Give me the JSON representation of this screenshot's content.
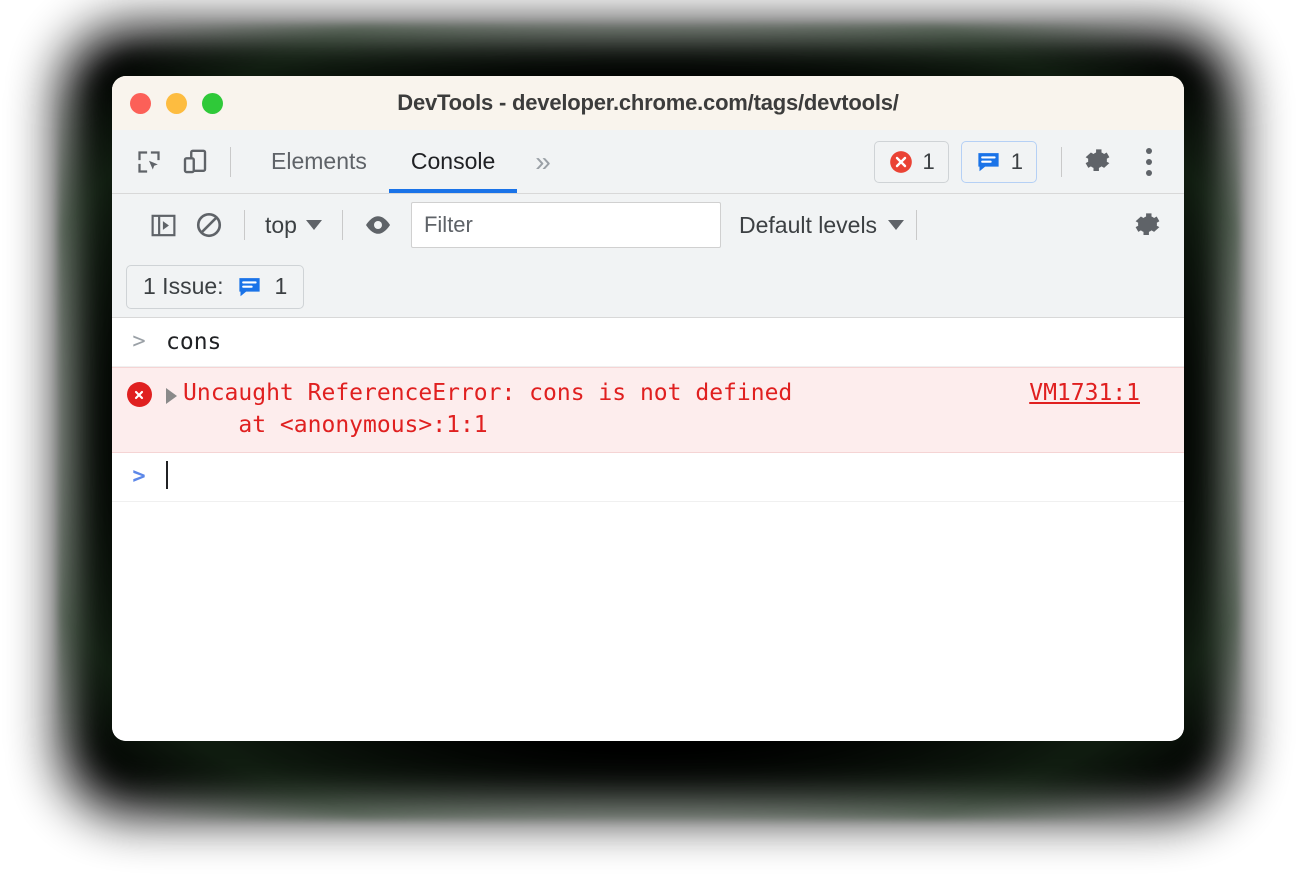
{
  "window": {
    "title": "DevTools - developer.chrome.com/tags/devtools/",
    "traffic_lights": [
      {
        "name": "close",
        "color": "#fc6058"
      },
      {
        "name": "minimize",
        "color": "#fdbc40"
      },
      {
        "name": "maximize",
        "color": "#2fc939"
      }
    ]
  },
  "main_toolbar": {
    "inspect_icon": "inspect-element-icon",
    "device_icon": "device-toolbar-icon",
    "tabs": [
      {
        "label": "Elements",
        "active": false
      },
      {
        "label": "Console",
        "active": true
      }
    ],
    "more_tabs_label": "»",
    "error_count": "1",
    "issue_count": "1",
    "settings_icon": "gear-icon",
    "more_options_icon": "kebab-menu-icon"
  },
  "console_toolbar": {
    "sidebar_icon": "console-sidebar-icon",
    "clear_icon": "clear-console-icon",
    "context": "top",
    "eye_icon": "live-expression-icon",
    "filter_placeholder": "Filter",
    "filter_value": "",
    "levels": "Default levels",
    "settings_icon": "gear-icon"
  },
  "issues_bar": {
    "label": "1 Issue:",
    "count": "1"
  },
  "console": {
    "entries": [
      {
        "type": "input",
        "prompt": ">",
        "text": "cons"
      },
      {
        "type": "error",
        "message": "Uncaught ReferenceError: cons is not defined",
        "stack": "    at <anonymous>:1:1",
        "link": "VM1731:1"
      },
      {
        "type": "prompt",
        "prompt": ">",
        "text": ""
      }
    ]
  },
  "colors": {
    "accent": "#1a73e8",
    "error": "#e02020",
    "error_bg": "#fdeded",
    "toolbar_bg": "#f1f3f4",
    "titlebar_bg": "#f9f4ed"
  }
}
